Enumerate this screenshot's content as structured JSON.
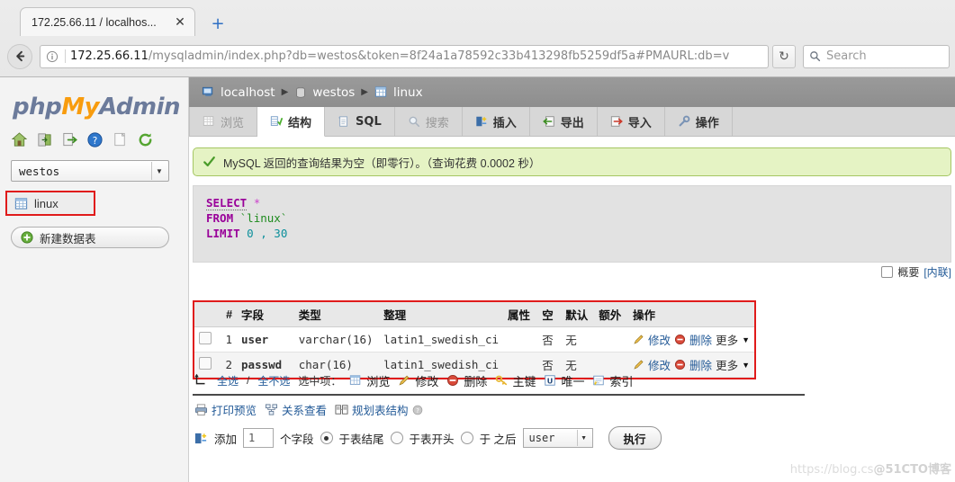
{
  "browser": {
    "tab_title": "172.25.66.11 / localhos...",
    "close_label": "✕",
    "newtab_label": "+",
    "url_host": "172.25.66.11",
    "url_rest": "/mysqladmin/index.php?db=westos&token=8f24a1a78592c33b413298fb5259df5a#PMAURL:db=v",
    "reload_label": "↻",
    "search_placeholder": "Search"
  },
  "sidebar": {
    "logo": {
      "php": "php",
      "my": "My",
      "admin": "Admin"
    },
    "nav_icons": [
      {
        "name": "home-icon"
      },
      {
        "name": "logout-icon"
      },
      {
        "name": "export-icon"
      },
      {
        "name": "help-icon"
      },
      {
        "name": "docs-icon"
      },
      {
        "name": "reload-icon"
      }
    ],
    "database_select": {
      "value": "westos"
    },
    "table_item": {
      "label": "linux"
    },
    "new_table": {
      "label": "新建数据表"
    }
  },
  "breadcrumb": {
    "server": "localhost",
    "database": "westos",
    "table": "linux",
    "separator": "▶"
  },
  "tabs": [
    {
      "label": "浏览",
      "icon": "browse-icon",
      "active": false,
      "dim": true
    },
    {
      "label": "结构",
      "icon": "structure-icon",
      "active": true,
      "dim": false
    },
    {
      "label": "SQL",
      "icon": "sql-icon",
      "active": false,
      "dim": false
    },
    {
      "label": "搜索",
      "icon": "search-icon",
      "active": false,
      "dim": true
    },
    {
      "label": "插入",
      "icon": "insert-icon",
      "active": false,
      "dim": false
    },
    {
      "label": "导出",
      "icon": "export-icon",
      "active": false,
      "dim": false
    },
    {
      "label": "导入",
      "icon": "import-icon",
      "active": false,
      "dim": false
    },
    {
      "label": "操作",
      "icon": "operations-icon",
      "active": false,
      "dim": false
    }
  ],
  "notice": {
    "text": "MySQL 返回的查询结果为空（即零行）。（查询花费 0.0002 秒）"
  },
  "sql": {
    "line1_kw": "SELECT",
    "line1_star": "*",
    "line2_kw": "FROM",
    "line2_tbl": "`linux`",
    "line3_kw": "LIMIT",
    "line3_a": "0",
    "line3_comma": ",",
    "line3_b": "30",
    "profiling_label": "概要",
    "inline_label": "[内联]"
  },
  "structure": {
    "columns": [
      "",
      "#",
      "字段",
      "类型",
      "整理",
      "属性",
      "空",
      "默认",
      "额外",
      "操作"
    ],
    "rows": [
      {
        "num": "1",
        "field": "user",
        "type": "varchar(16)",
        "collation": "latin1_swedish_ci",
        "attributes": "",
        "null": "否",
        "default": "无",
        "extra": "",
        "edit": "修改",
        "drop": "删除",
        "more": "更多",
        "caret": "▼"
      },
      {
        "num": "2",
        "field": "passwd",
        "type": "char(16)",
        "collation": "latin1_swedish_ci",
        "attributes": "",
        "null": "否",
        "default": "无",
        "extra": "",
        "edit": "修改",
        "drop": "删除",
        "more": "更多",
        "caret": "▼"
      }
    ]
  },
  "select_bar": {
    "select_all": "全选",
    "slash": "/",
    "select_none": "全不选",
    "with_selected": "选中项：",
    "actions": [
      {
        "label": "浏览",
        "icon": "browse-icon"
      },
      {
        "label": "修改",
        "icon": "edit-icon"
      },
      {
        "label": "删除",
        "icon": "drop-icon"
      },
      {
        "label": "主键",
        "icon": "primary-key-icon"
      },
      {
        "label": "唯一",
        "icon": "unique-icon"
      },
      {
        "label": "索引",
        "icon": "index-icon"
      }
    ]
  },
  "bottom_links": [
    {
      "label": "打印预览",
      "icon": "print-icon"
    },
    {
      "label": "关系查看",
      "icon": "relation-icon"
    },
    {
      "label": "规划表结构",
      "icon": "designer-icon"
    }
  ],
  "add_field_form": {
    "add_label": "添加",
    "count_value": "1",
    "fields_label": "个字段",
    "at_end_label": "于表结尾",
    "at_begin_label": "于表开头",
    "after_label": "于 之后",
    "after_select_value": "user",
    "go_label": "执行"
  },
  "watermark": {
    "url": "https://blog.cs",
    "brand": "@51CTO博客"
  },
  "colors": {
    "accent_link": "#235a97",
    "highlight_border": "#e01b1b",
    "success_bg": "#e5f3c4",
    "brand_orange": "#f89c0e",
    "brand_blue": "#6c7b9b"
  }
}
